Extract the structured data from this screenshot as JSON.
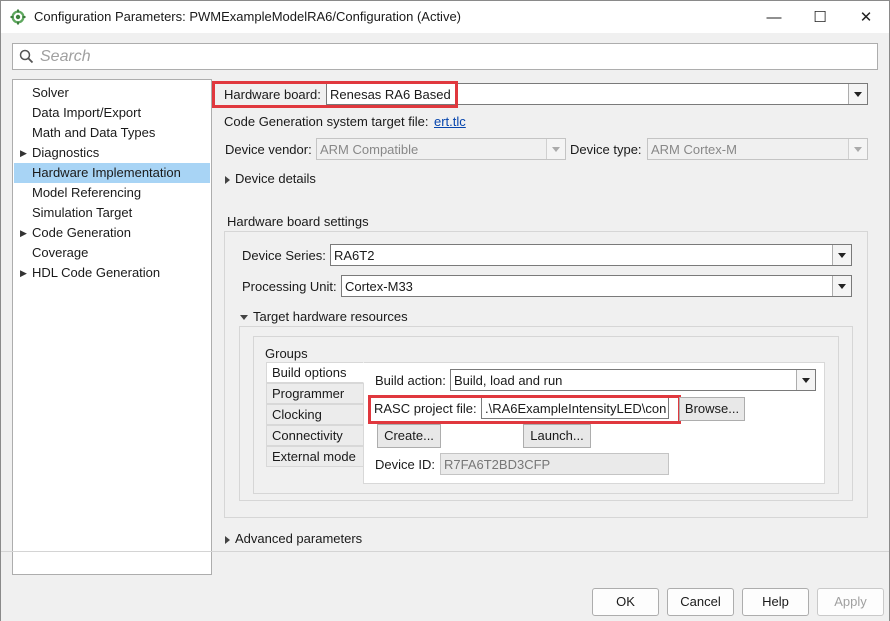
{
  "window": {
    "title": "Configuration Parameters: PWMExampleModelRA6/Configuration (Active)",
    "minimize": "—",
    "maximize": "☐",
    "close": "✕"
  },
  "search": {
    "placeholder": "Search"
  },
  "tree": {
    "items": [
      {
        "label": "Solver",
        "expandable": false
      },
      {
        "label": "Data Import/Export",
        "expandable": false
      },
      {
        "label": "Math and Data Types",
        "expandable": false
      },
      {
        "label": "Diagnostics",
        "expandable": true
      },
      {
        "label": "Hardware Implementation",
        "expandable": false,
        "selected": true
      },
      {
        "label": "Model Referencing",
        "expandable": false
      },
      {
        "label": "Simulation Target",
        "expandable": false
      },
      {
        "label": "Code Generation",
        "expandable": true
      },
      {
        "label": "Coverage",
        "expandable": false
      },
      {
        "label": "HDL Code Generation",
        "expandable": true
      }
    ]
  },
  "hardware": {
    "board_label": "Hardware board:",
    "board_value": "Renesas RA6 Based",
    "target_file_label": "Code Generation system target file:",
    "target_file_link": "ert.tlc",
    "vendor_label": "Device vendor:",
    "vendor_value": "ARM Compatible",
    "type_label": "Device type:",
    "type_value": "ARM Cortex-M",
    "device_details": "Device details",
    "board_settings_title": "Hardware board settings",
    "series_label": "Device Series:",
    "series_value": "RA6T2",
    "unit_label": "Processing Unit:",
    "unit_value": "Cortex-M33",
    "target_resources": "Target hardware resources",
    "groups_title": "Groups",
    "groups": [
      "Build options",
      "Programmer",
      "Clocking",
      "Connectivity",
      "External mode"
    ],
    "build_action_label": "Build action:",
    "build_action_value": "Build, load and run",
    "rasc_label": "RASC project file:",
    "rasc_value": ".\\RA6ExampleIntensityLED\\con",
    "browse_button": "Browse...",
    "create_button": "Create...",
    "launch_button": "Launch...",
    "device_id_label": "Device ID:",
    "device_id_value": "R7FA6T2BD3CFP",
    "advanced": "Advanced parameters"
  },
  "footer": {
    "ok": "OK",
    "cancel": "Cancel",
    "help": "Help",
    "apply": "Apply"
  },
  "colors": {
    "highlight": "#e0383e",
    "selection": "#a8d4f5",
    "link": "#0645ad"
  }
}
